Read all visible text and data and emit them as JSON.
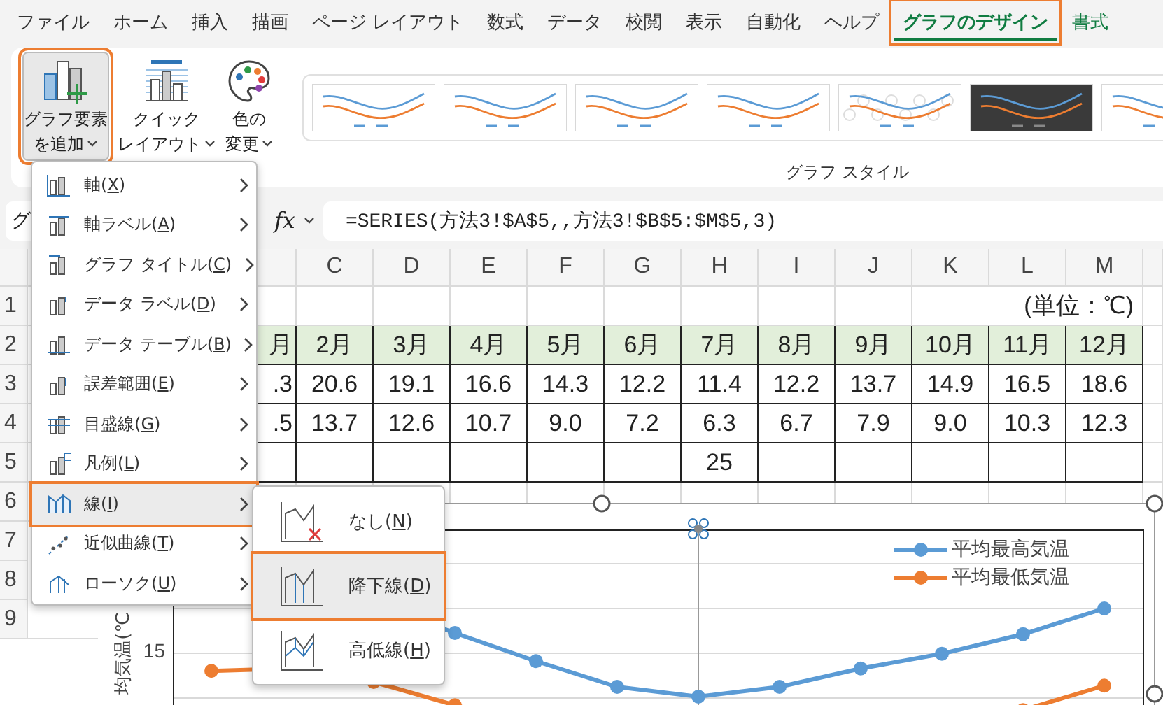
{
  "tabs": [
    {
      "label": "ファイル",
      "selected": false,
      "contextual": false
    },
    {
      "label": "ホーム",
      "selected": false,
      "contextual": false
    },
    {
      "label": "挿入",
      "selected": false,
      "contextual": false
    },
    {
      "label": "描画",
      "selected": false,
      "contextual": false
    },
    {
      "label": "ページ レイアウト",
      "selected": false,
      "contextual": false
    },
    {
      "label": "数式",
      "selected": false,
      "contextual": false
    },
    {
      "label": "データ",
      "selected": false,
      "contextual": false
    },
    {
      "label": "校閲",
      "selected": false,
      "contextual": false
    },
    {
      "label": "表示",
      "selected": false,
      "contextual": false
    },
    {
      "label": "自動化",
      "selected": false,
      "contextual": false
    },
    {
      "label": "ヘルプ",
      "selected": false,
      "contextual": false
    },
    {
      "label": "グラフのデザイン",
      "selected": true,
      "contextual": true
    },
    {
      "label": "書式",
      "selected": false,
      "contextual": true
    }
  ],
  "ribbon": {
    "buttons": [
      {
        "label_lines": [
          "グラフ要素",
          "を追加"
        ],
        "selected": true
      },
      {
        "label_lines": [
          "クイック",
          "レイアウト"
        ],
        "selected": false
      },
      {
        "label_lines": [
          "色の",
          "変更"
        ],
        "selected": false
      }
    ],
    "chart_styles": {
      "thumbnails": [
        {
          "kind": "plain"
        },
        {
          "kind": "plain"
        },
        {
          "kind": "plain"
        },
        {
          "kind": "plain"
        },
        {
          "kind": "pattern"
        },
        {
          "kind": "dark"
        },
        {
          "kind": "plain"
        }
      ],
      "label": "グラフ スタイル"
    }
  },
  "formula_bar": {
    "name_box": "グ",
    "function_label": "fx",
    "formula": "=SERIES(方法3!$A$5,,方法3!$B$5:$M$5,3)"
  },
  "sheet": {
    "columns": [
      null,
      "C",
      "D",
      "E",
      "F",
      "G",
      "H",
      "I",
      "J",
      "K",
      "L",
      "M"
    ],
    "row_numbers": [
      "1",
      "2",
      "3",
      "4",
      "5",
      "6",
      "7",
      "8",
      "9"
    ],
    "unit_note": "(単位：℃)",
    "rows": [
      [
        "月",
        "2月",
        "3月",
        "4月",
        "5月",
        "6月",
        "7月",
        "8月",
        "9月",
        "10月",
        "11月",
        "12月"
      ],
      [
        ".3",
        "20.6",
        "19.1",
        "16.6",
        "14.3",
        "12.2",
        "11.4",
        "12.2",
        "13.7",
        "14.9",
        "16.5",
        "18.6"
      ],
      [
        ".5",
        "13.7",
        "12.6",
        "10.7",
        "9.0",
        "7.2",
        "6.3",
        "6.7",
        "7.9",
        "9.0",
        "10.3",
        "12.3"
      ],
      [
        null,
        null,
        null,
        null,
        null,
        null,
        "25",
        null,
        null,
        null,
        null,
        null
      ]
    ]
  },
  "chart": {
    "tick_label": "15",
    "axis_title": "均気温(℃",
    "legend": [
      {
        "label": "平均最高気温",
        "color": "#5b9bd5"
      },
      {
        "label": "平均最低気温",
        "color": "#ed7d31"
      }
    ]
  },
  "menu": {
    "items": [
      {
        "label": "軸(X)",
        "selected": false
      },
      {
        "label": "軸ラベル(A)",
        "selected": false
      },
      {
        "label": "グラフ タイトル(C)",
        "selected": false
      },
      {
        "label": "データ ラベル(D)",
        "selected": false
      },
      {
        "label": "データ テーブル(B)",
        "selected": false
      },
      {
        "label": "誤差範囲(E)",
        "selected": false
      },
      {
        "label": "目盛線(G)",
        "selected": false
      },
      {
        "label": "凡例(L)",
        "selected": false
      },
      {
        "label": "線(I)",
        "selected": true
      },
      {
        "label": "近似曲線(T)",
        "selected": false
      },
      {
        "label": "ローソク(U)",
        "selected": false
      }
    ]
  },
  "submenu": {
    "items": [
      {
        "label": "なし(N)",
        "selected": false
      },
      {
        "label": "降下線(D)",
        "selected": true
      },
      {
        "label": "高低線(H)",
        "selected": false
      }
    ]
  }
}
